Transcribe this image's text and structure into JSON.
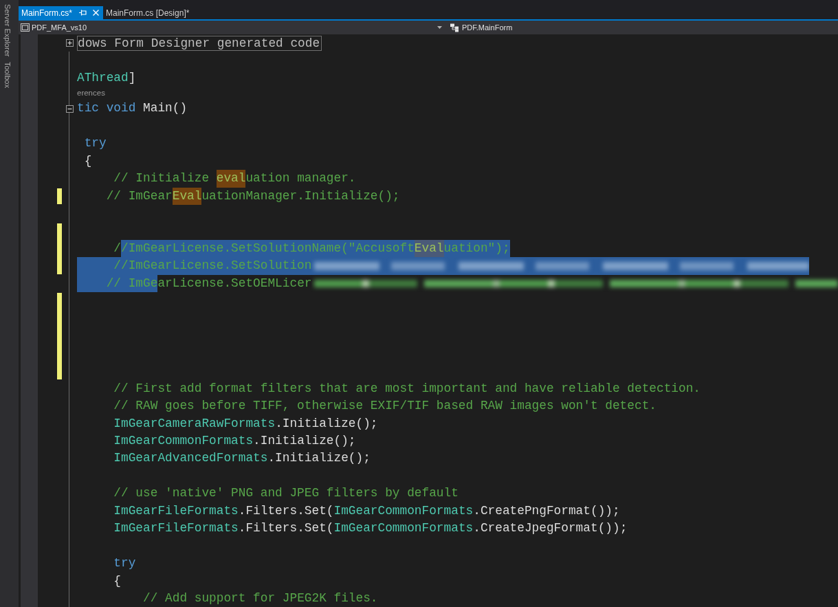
{
  "tool_windows": [
    "Server Explorer",
    "Toolbox"
  ],
  "tabs": [
    {
      "label": "MainForm.cs*",
      "selected": true
    },
    {
      "label": "MainForm.cs [Design]*",
      "selected": false
    }
  ],
  "navigation": {
    "project": "PDF_MFA_vs10",
    "type": "PDF.MainForm"
  },
  "lines": [
    {
      "kind": "region",
      "changed": false,
      "fold": {
        "expanded": false
      },
      "segments": [
        {
          "text": "dows Form Designer generated code",
          "kind": "plain"
        }
      ]
    },
    {
      "kind": "code",
      "changed": false
    },
    {
      "kind": "code",
      "changed": false,
      "segments": [
        {
          "text": "AThread",
          "kind": "type"
        },
        {
          "text": "]",
          "kind": "plain"
        }
      ]
    },
    {
      "kind": "codelens",
      "changed": false,
      "segments": [
        {
          "text": "erences",
          "kind": "plain"
        }
      ]
    },
    {
      "kind": "code",
      "changed": false,
      "fold": {
        "expanded": true
      },
      "segments": [
        {
          "text": "tic void",
          "kind": "keyword"
        },
        {
          "text": " Main()",
          "kind": "plain"
        }
      ]
    },
    {
      "kind": "code",
      "changed": false
    },
    {
      "kind": "code",
      "changed": false,
      "segments": [
        {
          "text": " try",
          "kind": "keyword"
        }
      ]
    },
    {
      "kind": "code",
      "changed": false,
      "segments": [
        {
          "text": " {",
          "kind": "plain"
        }
      ]
    },
    {
      "kind": "code",
      "changed": false,
      "segments": [
        {
          "text": "     // Initialize ",
          "kind": "comment"
        },
        {
          "text": "eval",
          "kind": "match"
        },
        {
          "text": "uation manager.",
          "kind": "comment"
        }
      ]
    },
    {
      "kind": "code",
      "changed": true,
      "segments": [
        {
          "text": "    // ImGear",
          "kind": "comment"
        },
        {
          "text": "Eval",
          "kind": "match"
        },
        {
          "text": "uationManager.Initialize();",
          "kind": "comment"
        }
      ]
    },
    {
      "kind": "code",
      "changed": false
    },
    {
      "kind": "code",
      "changed": true
    },
    {
      "kind": "code",
      "changed": true,
      "segments": [
        {
          "text": "     /",
          "kind": "comment",
          "selected": false
        },
        {
          "text": "/ImGearLicense.SetSolutionName(\"Accusoft",
          "kind": "comment",
          "selected": true
        },
        {
          "text": "Eval",
          "kind": "match",
          "selected": true
        },
        {
          "text": "uation\");",
          "kind": "comment",
          "selected": true
        }
      ]
    },
    {
      "kind": "code",
      "changed": true,
      "segments": [
        {
          "text": "     //ImGearLicense.SetSolution",
          "kind": "comment",
          "selected": true
        }
      ],
      "redaction": {
        "selected": true
      }
    },
    {
      "kind": "code",
      "changed": false,
      "segments": [
        {
          "text": "    // ImGe",
          "kind": "comment",
          "selected": true
        },
        {
          "text": "arLicense.SetOEMLicer",
          "kind": "comment",
          "selected": false
        }
      ],
      "redaction": {
        "selected": false
      }
    },
    {
      "kind": "code",
      "changed": true
    },
    {
      "kind": "code",
      "changed": true
    },
    {
      "kind": "code",
      "changed": true
    },
    {
      "kind": "code",
      "changed": true
    },
    {
      "kind": "code",
      "changed": true
    },
    {
      "kind": "code",
      "changed": false,
      "segments": [
        {
          "text": "     // First add format filters that are most important and have reliable detection.",
          "kind": "comment"
        }
      ]
    },
    {
      "kind": "code",
      "changed": false,
      "segments": [
        {
          "text": "     // RAW goes before TIFF, otherwise EXIF/TIF based RAW images won't detect.",
          "kind": "comment"
        }
      ]
    },
    {
      "kind": "code",
      "changed": false,
      "segments": [
        {
          "text": "     ImGearCameraRawFormats",
          "kind": "type"
        },
        {
          "text": ".Initialize();",
          "kind": "plain"
        }
      ]
    },
    {
      "kind": "code",
      "changed": false,
      "segments": [
        {
          "text": "     ImGearCommonFormats",
          "kind": "type"
        },
        {
          "text": ".Initialize();",
          "kind": "plain"
        }
      ]
    },
    {
      "kind": "code",
      "changed": false,
      "segments": [
        {
          "text": "     ImGearAdvancedFormats",
          "kind": "type"
        },
        {
          "text": ".Initialize();",
          "kind": "plain"
        }
      ]
    },
    {
      "kind": "code",
      "changed": false
    },
    {
      "kind": "code",
      "changed": false,
      "segments": [
        {
          "text": "     // use 'native' PNG and JPEG filters by default",
          "kind": "comment"
        }
      ]
    },
    {
      "kind": "code",
      "changed": false,
      "segments": [
        {
          "text": "     ImGearFileFormats",
          "kind": "type"
        },
        {
          "text": ".Filters.Set(",
          "kind": "plain"
        },
        {
          "text": "ImGearCommonFormats",
          "kind": "type"
        },
        {
          "text": ".CreatePngFormat());",
          "kind": "plain"
        }
      ]
    },
    {
      "kind": "code",
      "changed": false,
      "segments": [
        {
          "text": "     ImGearFileFormats",
          "kind": "type"
        },
        {
          "text": ".Filters.Set(",
          "kind": "plain"
        },
        {
          "text": "ImGearCommonFormats",
          "kind": "type"
        },
        {
          "text": ".CreateJpegFormat());",
          "kind": "plain"
        }
      ]
    },
    {
      "kind": "code",
      "changed": false
    },
    {
      "kind": "code",
      "changed": false,
      "segments": [
        {
          "text": "     try",
          "kind": "keyword"
        }
      ]
    },
    {
      "kind": "code",
      "changed": false,
      "segments": [
        {
          "text": "     {",
          "kind": "plain"
        }
      ]
    },
    {
      "kind": "code",
      "changed": false,
      "segments": [
        {
          "text": "         // Add support for JPEG2K files.",
          "kind": "comment"
        }
      ]
    }
  ]
}
